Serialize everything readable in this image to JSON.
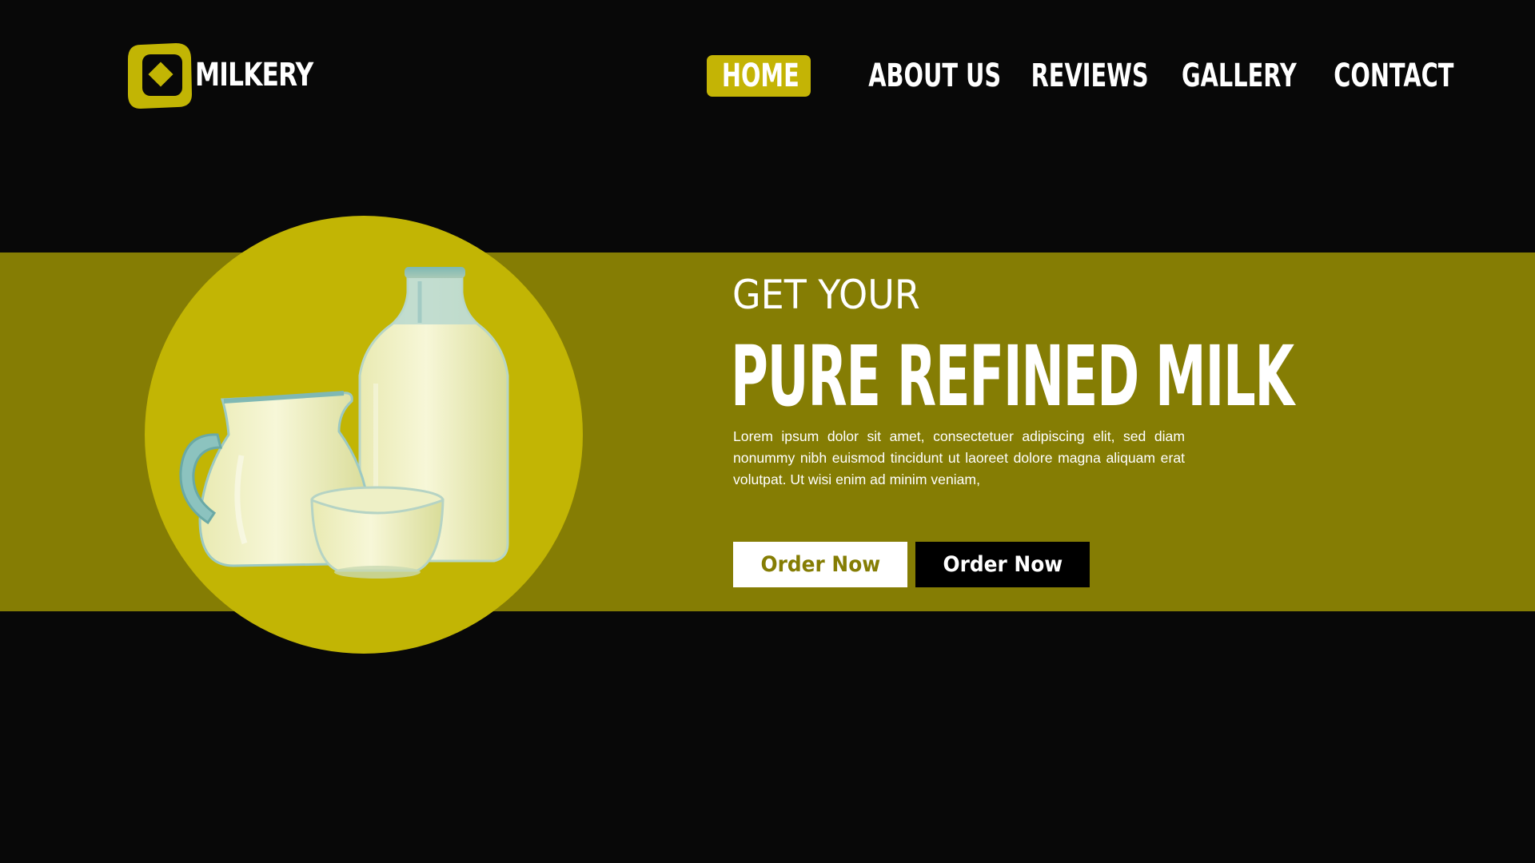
{
  "brand": {
    "name": "MILKERY",
    "logo_icon": "diamond-badge-icon"
  },
  "nav": {
    "items": [
      {
        "label": "HOME",
        "active": true
      },
      {
        "label": "ABOUT US",
        "active": false
      },
      {
        "label": "REVIEWS",
        "active": false
      },
      {
        "label": "GALLERY",
        "active": false
      },
      {
        "label": "CONTACT",
        "active": false
      }
    ]
  },
  "hero": {
    "subtitle": "GET YOUR",
    "title": "PURE REFINED MILK",
    "body": "Lorem ipsum dolor sit amet, consectetuer adipiscing elit, sed diam nonummy nibh euismod tincidunt ut laoreet dolore magna aliquam erat volutpat. Ut wisi enim ad minim veniam,",
    "image_alt": "milk jug, bottle and bowl",
    "buttons": [
      {
        "label": "Order Now",
        "style": "light"
      },
      {
        "label": "Order Now",
        "style": "dark"
      }
    ]
  },
  "colors": {
    "background": "#080808",
    "band": "#857d04",
    "accent": "#c2b504",
    "text": "#ffffff"
  }
}
